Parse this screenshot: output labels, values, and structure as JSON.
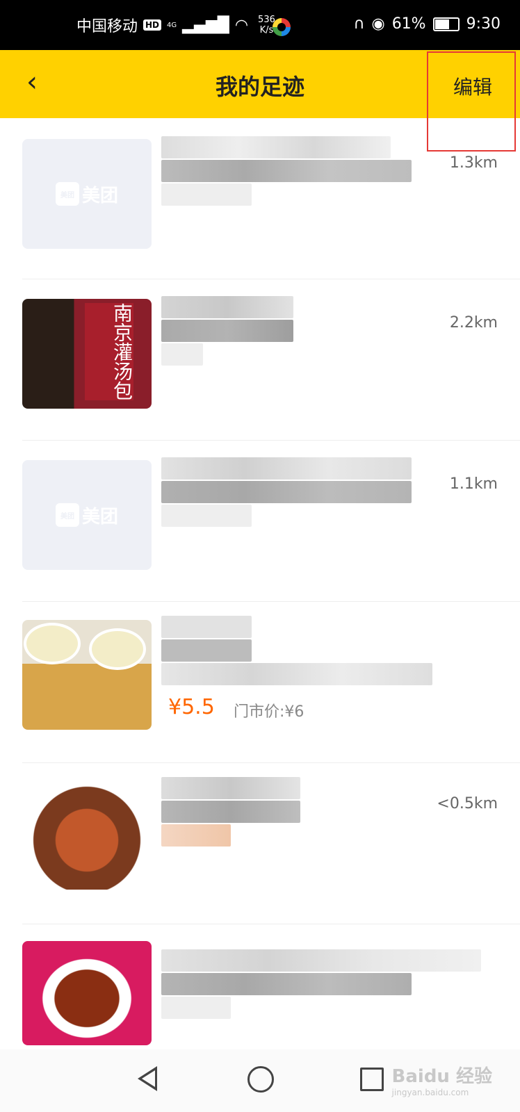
{
  "status_bar": {
    "carrier": "中国移动",
    "hd_badge": "HD",
    "network": "4G",
    "speed_value": "536",
    "speed_unit": "K/s",
    "battery_percent": "61%",
    "battery_level": 0.61,
    "time": "9:30"
  },
  "header": {
    "title": "我的足迹",
    "edit_label": "编辑",
    "accent_color": "#ffd100"
  },
  "items": [
    {
      "distance": "1.3km",
      "thumb_label": "美团"
    },
    {
      "distance": "2.2km",
      "thumb_label": "南京灌汤包"
    },
    {
      "distance": "1.1km",
      "thumb_label": "美团"
    },
    {
      "price": "¥5.5",
      "market_price": "门市价:¥6"
    },
    {
      "distance": "<0.5km"
    },
    {
      "distance": ""
    }
  ],
  "watermark": {
    "text": "Baidu 经验",
    "sub": "jingyan.baidu.com"
  }
}
